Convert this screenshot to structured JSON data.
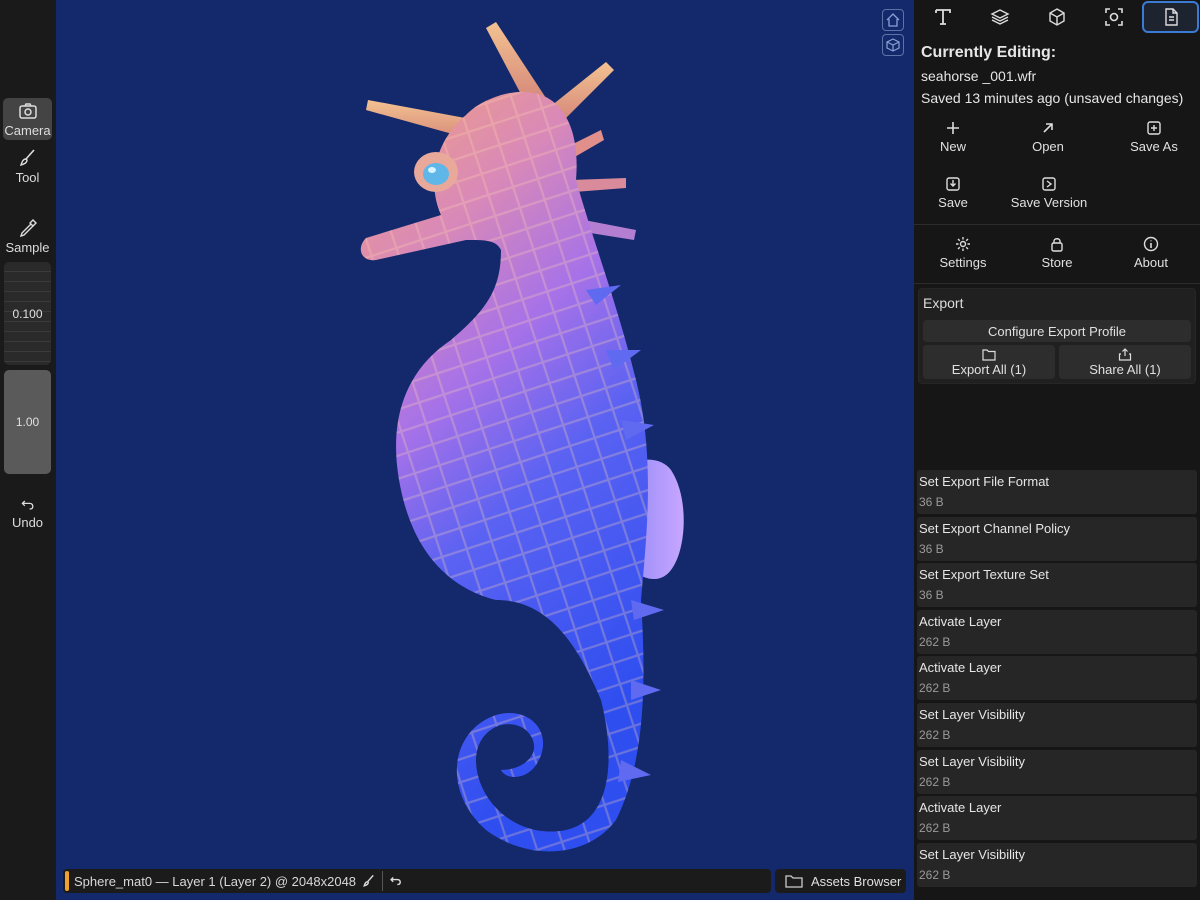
{
  "left_toolbar": {
    "camera_label": "Camera",
    "tool_label": "Tool",
    "sample_label": "Sample",
    "size_value": "0.100",
    "opacity_value": "1.00",
    "undo_label": "Undo"
  },
  "viewport": {
    "status_text": "Sphere_mat0 — Layer 1 (Layer 2) @ 2048x2048",
    "assets_label": "Assets Browser",
    "background_color": "#13296b",
    "icons": [
      "home-view-icon",
      "cube-view-icon"
    ]
  },
  "right_panel": {
    "tabs": [
      "text-tool-icon",
      "layers-icon",
      "cube-icon",
      "focus-icon",
      "document-icon"
    ],
    "active_tab": "document-icon",
    "editing_title": "Currently Editing:",
    "filename": "seahorse _001.wfr",
    "saved_status": "Saved 13 minutes ago (unsaved changes)",
    "actions": {
      "new": "New",
      "open": "Open",
      "save_as": "Save As",
      "save": "Save",
      "save_version": "Save Version",
      "settings": "Settings",
      "store": "Store",
      "about": "About"
    },
    "export": {
      "label": "Export",
      "configure": "Configure Export Profile",
      "export_all": "Export All (1)",
      "share_all": "Share All (1)"
    },
    "history": [
      {
        "title": "Set Export File Format",
        "size": "36 B"
      },
      {
        "title": "Set Export Channel Policy",
        "size": "36 B"
      },
      {
        "title": "Set Export Texture Set",
        "size": "36 B"
      },
      {
        "title": "Activate Layer",
        "size": "262 B"
      },
      {
        "title": "Activate Layer",
        "size": "262 B"
      },
      {
        "title": "Set Layer Visibility",
        "size": "262 B"
      },
      {
        "title": "Set Layer Visibility",
        "size": "262 B"
      },
      {
        "title": "Activate Layer",
        "size": "262 B"
      },
      {
        "title": "Set Layer Visibility",
        "size": "262 B"
      }
    ]
  },
  "colors": {
    "accent": "#3a7bd5",
    "status_accent": "#f0a030"
  }
}
